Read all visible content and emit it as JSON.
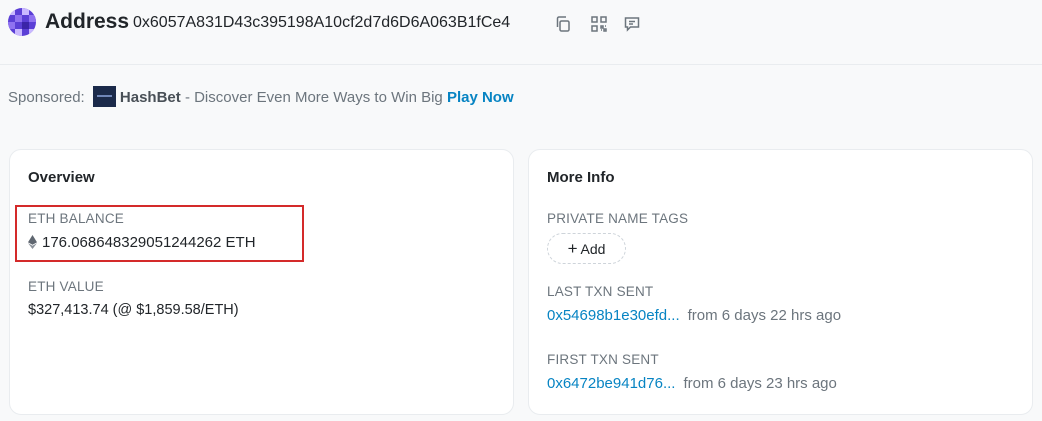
{
  "header": {
    "title": "Address",
    "address": "0x6057A831D43c395198A10cf2d7d6D6A063B1fCe4",
    "icons": [
      "copy-icon",
      "qr-code-icon",
      "comment-icon"
    ]
  },
  "sponsored": {
    "prefix": "Sponsored:",
    "brand": "HashBet",
    "text": "- Discover Even More Ways to Win Big",
    "cta": "Play Now"
  },
  "overview": {
    "title": "Overview",
    "eth_balance_label": "ETH BALANCE",
    "eth_balance_value": "176.068648329051244262 ETH",
    "eth_value_label": "ETH VALUE",
    "eth_value_value": "$327,413.74 (@ $1,859.58/ETH)"
  },
  "more_info": {
    "title": "More Info",
    "private_tags_label": "PRIVATE NAME TAGS",
    "add_label": "Add",
    "last_txn_label": "LAST TXN SENT",
    "last_txn_hash": "0x54698b1e30efd...",
    "last_txn_time": "from 6 days 22 hrs ago",
    "first_txn_label": "FIRST TXN SENT",
    "first_txn_hash": "0x6472be941d76...",
    "first_txn_time": "from 6 days 23 hrs ago"
  },
  "colors": {
    "link": "#0784c3",
    "highlight": "#d42a2a",
    "muted": "#6c757d"
  }
}
